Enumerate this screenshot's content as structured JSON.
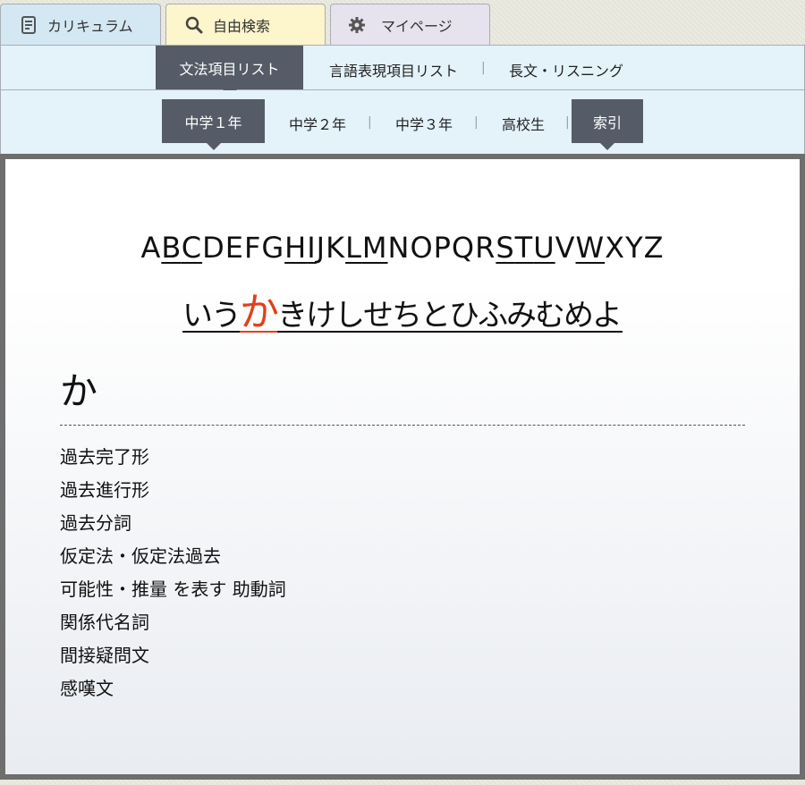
{
  "top_tabs": [
    {
      "label": "カリキュラム",
      "icon": "document-icon"
    },
    {
      "label": "自由検索",
      "icon": "search-icon"
    },
    {
      "label": "マイページ",
      "icon": "gear-icon"
    }
  ],
  "category_nav": {
    "items": [
      "文法項目リスト",
      "言語表現項目リスト",
      "長文・リスニング"
    ],
    "active": "文法項目リスト"
  },
  "level_nav": {
    "items": [
      "中学１年",
      "中学２年",
      "中学３年",
      "高校生",
      "索引"
    ],
    "active": [
      "中学１年",
      "索引"
    ]
  },
  "index": {
    "alphabet": [
      {
        "ch": "A",
        "link": false
      },
      {
        "ch": "B",
        "link": true
      },
      {
        "ch": "C",
        "link": true
      },
      {
        "ch": "D",
        "link": false
      },
      {
        "ch": "E",
        "link": false
      },
      {
        "ch": "F",
        "link": false
      },
      {
        "ch": "G",
        "link": false
      },
      {
        "ch": "H",
        "link": true
      },
      {
        "ch": "I",
        "link": true
      },
      {
        "ch": "J",
        "link": false
      },
      {
        "ch": "K",
        "link": false
      },
      {
        "ch": "L",
        "link": true
      },
      {
        "ch": "M",
        "link": true
      },
      {
        "ch": "N",
        "link": false
      },
      {
        "ch": "O",
        "link": false
      },
      {
        "ch": "P",
        "link": false
      },
      {
        "ch": "Q",
        "link": false
      },
      {
        "ch": "R",
        "link": false
      },
      {
        "ch": "S",
        "link": true
      },
      {
        "ch": "T",
        "link": true
      },
      {
        "ch": "U",
        "link": true
      },
      {
        "ch": "V",
        "link": false
      },
      {
        "ch": "W",
        "link": true
      },
      {
        "ch": "X",
        "link": false
      },
      {
        "ch": "Y",
        "link": false
      },
      {
        "ch": "Z",
        "link": false
      }
    ],
    "kana": [
      "い",
      "う",
      "か",
      "き",
      "け",
      "し",
      "せ",
      "ち",
      "と",
      "ひ",
      "ふ",
      "み",
      "む",
      "め",
      "よ"
    ],
    "selected_kana": "か"
  },
  "section": {
    "heading": "か",
    "items": [
      "過去完了形",
      "過去進行形",
      "過去分詞",
      "仮定法・仮定法過去",
      "可能性・推量 を表す 助動詞",
      "関係代名詞",
      "間接疑問文",
      "感嘆文"
    ]
  },
  "colors": {
    "active_nav_bg": "#555b67",
    "selected_kana": "#e2401c",
    "nav_bg": "#e4f2fa",
    "panel_border": "#6e6e6e"
  }
}
